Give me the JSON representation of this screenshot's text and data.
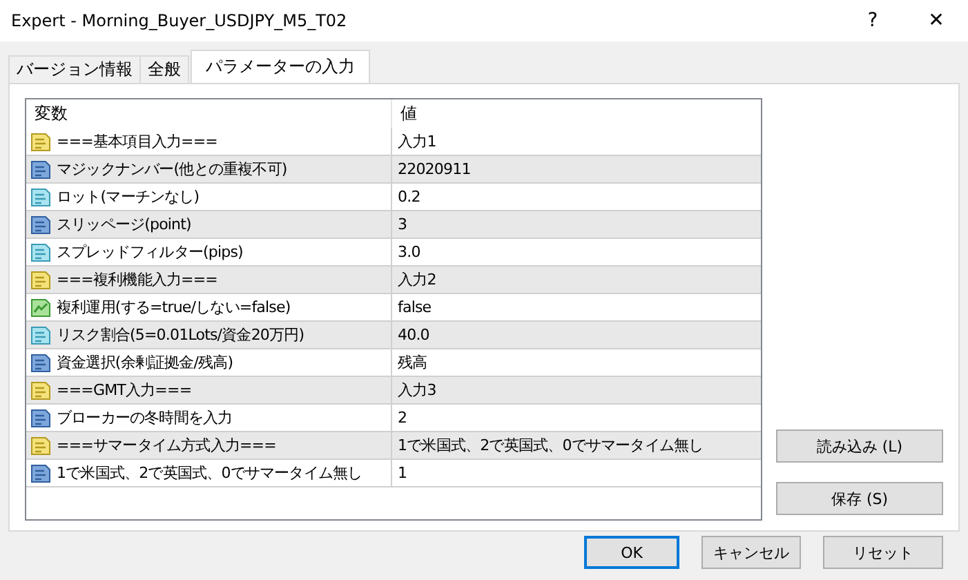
{
  "window": {
    "title": "Expert - Morning_Buyer_USDJPY_M5_T02",
    "help": "?",
    "close": "✕"
  },
  "tabs": [
    {
      "label": "バージョン情報",
      "selected": false
    },
    {
      "label": "全般",
      "selected": false
    },
    {
      "label": "パラメーターの入力",
      "selected": true
    }
  ],
  "table": {
    "columns": [
      "変数",
      "値"
    ],
    "rows": [
      {
        "kind": "string",
        "name": "===基本項目入力===",
        "value": "入力1"
      },
      {
        "kind": "int",
        "name": "マジックナンバー(他との重複不可)",
        "value": "22020911"
      },
      {
        "kind": "double",
        "name": "ロット(マーチンなし)",
        "value": "0.2"
      },
      {
        "kind": "int",
        "name": "スリッページ(point)",
        "value": "3"
      },
      {
        "kind": "double",
        "name": "スプレッドフィルター(pips)",
        "value": "3.0"
      },
      {
        "kind": "string",
        "name": "===複利機能入力===",
        "value": "入力2"
      },
      {
        "kind": "bool",
        "name": "複利運用(する=true/しない=false)",
        "value": "false"
      },
      {
        "kind": "double",
        "name": "リスク割合(5=0.01Lots/資金20万円)",
        "value": "40.0"
      },
      {
        "kind": "int",
        "name": "資金選択(余剰証拠金/残高)",
        "value": "残高"
      },
      {
        "kind": "string",
        "name": "===GMT入力===",
        "value": "入力3"
      },
      {
        "kind": "int",
        "name": "ブローカーの冬時間を入力",
        "value": "2"
      },
      {
        "kind": "string",
        "name": "===サマータイム方式入力===",
        "value": "1で米国式、2で英国式、0でサマータイム無し"
      },
      {
        "kind": "int",
        "name": "1で米国式、2で英国式、0でサマータイム無し",
        "value": "1"
      }
    ]
  },
  "side_buttons": [
    "読み込み (L)",
    "保存 (S)"
  ],
  "buttons": [
    {
      "label": "OK",
      "default": true
    },
    {
      "label": "キャンセル",
      "default": false
    },
    {
      "label": "リセット",
      "default": false
    }
  ]
}
